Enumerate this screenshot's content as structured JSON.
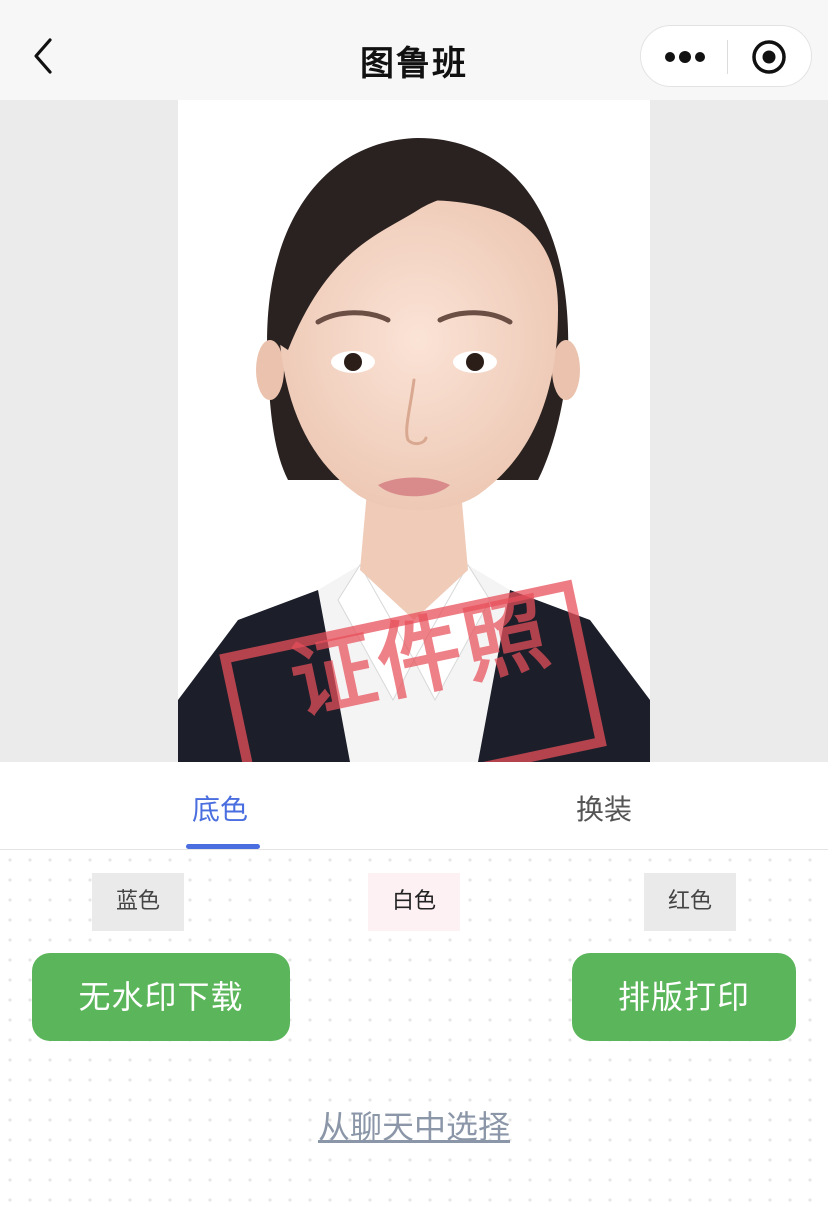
{
  "header": {
    "title": "图鲁班",
    "icons": {
      "back": "chevron-left-icon",
      "more": "more-dots-icon",
      "close": "target-close-icon"
    }
  },
  "photo": {
    "background_color": "#ffffff",
    "watermark_text": "证件照",
    "watermark_color": "#e8505b"
  },
  "tabs": [
    {
      "label": "底色",
      "active": true
    },
    {
      "label": "换装",
      "active": false
    }
  ],
  "colors": [
    {
      "label": "蓝色"
    },
    {
      "label": "白色",
      "selected": true
    },
    {
      "label": "红色"
    }
  ],
  "buttons": {
    "download_label": "无水印下载",
    "print_label": "排版打印"
  },
  "link": {
    "label": "从聊天中选择"
  },
  "theme": {
    "accent": "#4a6ee0",
    "button_green": "#5bb55a",
    "link_gray": "#8b97a8"
  }
}
